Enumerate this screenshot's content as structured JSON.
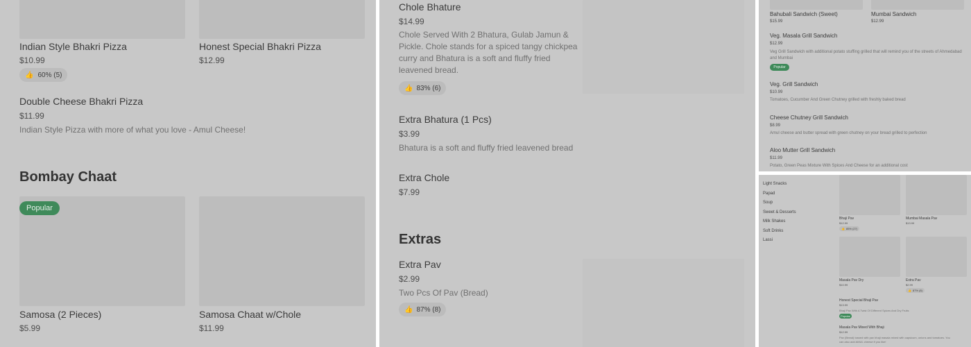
{
  "panel1": {
    "items_top": [
      {
        "title": "Indian Style Bhakri Pizza",
        "price": "$10.99",
        "rating": "60% (5)"
      },
      {
        "title": "Honest Special Bhakri Pizza",
        "price": "$12.99"
      }
    ],
    "double_cheese": {
      "title": "Double Cheese Bhakri Pizza",
      "price": "$11.99",
      "desc": "Indian Style Pizza with more of what you love - Amul Cheese!"
    },
    "section": "Bombay Chaat",
    "badge": "Popular",
    "items_bottom": [
      {
        "title": "Samosa (2 Pieces)",
        "price": "$5.99"
      },
      {
        "title": "Samosa Chaat w/Chole",
        "price": "$11.99"
      }
    ]
  },
  "panel2": {
    "chole": {
      "title": "Chole Bhature",
      "price": "$14.99",
      "desc": "Chole Served With 2 Bhatura, Gulab Jamun & Pickle. Chole stands for a spiced tangy chickpea curry and Bhatura is a soft and fluffy fried leavened bread.",
      "rating": "83% (6)"
    },
    "extra_bhatura": {
      "title": "Extra Bhatura (1 Pcs)",
      "price": "$3.99",
      "desc": "Bhatura is a soft and fluffy fried leavened bread"
    },
    "extra_chole": {
      "title": "Extra Chole",
      "price": "$7.99"
    },
    "section": "Extras",
    "extra_pav": {
      "title": "Extra Pav",
      "price": "$2.99",
      "desc": "Two Pcs Of Pav (Bread)",
      "rating": "87% (8)"
    }
  },
  "panel3": {
    "top_items": [
      {
        "title": "Bahubali Sandwich (Sweet)",
        "price": "$15.99"
      },
      {
        "title": "Mumbai Sandwich",
        "price": "$12.99"
      }
    ],
    "items": [
      {
        "title": "Veg. Masala Grill Sandwich",
        "price": "$12.99",
        "desc": "Veg Grill Sandwich with additional potato stuffing grilled that will remind you of the streets of Ahmedabad and Mumbai",
        "badge": "Popular"
      },
      {
        "title": "Veg. Grill Sandwich",
        "price": "$10.99",
        "desc": "Tomatoes, Cucumber And Green Chutney grilled with freshly baked bread"
      },
      {
        "title": "Cheese Chutney Grill Sandwich",
        "price": "$8.99",
        "desc": "Amul cheese and butter spread with green chutney on your bread grilled to perfection"
      },
      {
        "title": "Aloo Mutter Grill Sandwich",
        "price": "$11.99",
        "desc": "Potato, Green Peas Mixture With Spices And Cheese for an additional cost"
      }
    ]
  },
  "panel4": {
    "sidebar": [
      "Light Snacks",
      "Papad",
      "Soup",
      "Sweet & Desserts",
      "Milk Shakes",
      "Soft Drinks",
      "Lassi"
    ],
    "grid": [
      {
        "title": "Bhaji Pav",
        "price": "$12.99",
        "rating": "85% (27)"
      },
      {
        "title": "Mumbai Masala Pav",
        "price": "$13.99"
      },
      {
        "title": "Masala Pav Dry",
        "price": "$10.99"
      },
      {
        "title": "Extra Pav",
        "price": "$2.99",
        "rating": "87% (8)"
      }
    ],
    "honest": {
      "title": "Honest Special Bhaji Pav",
      "price": "$13.99",
      "desc": "Bhaji Pav With A Twist Of Different Spices And Dry Fruits",
      "badge": "Popular"
    },
    "mixed": {
      "title": "Masala Pav Mixed With Bhaji",
      "price": "$12.99",
      "desc1": "Pav (Bread) tossed with pav bhaji masala mixed with capsicum, onions and tomatoes. You",
      "desc2": "can also add AMUL cheese if you like!"
    }
  }
}
